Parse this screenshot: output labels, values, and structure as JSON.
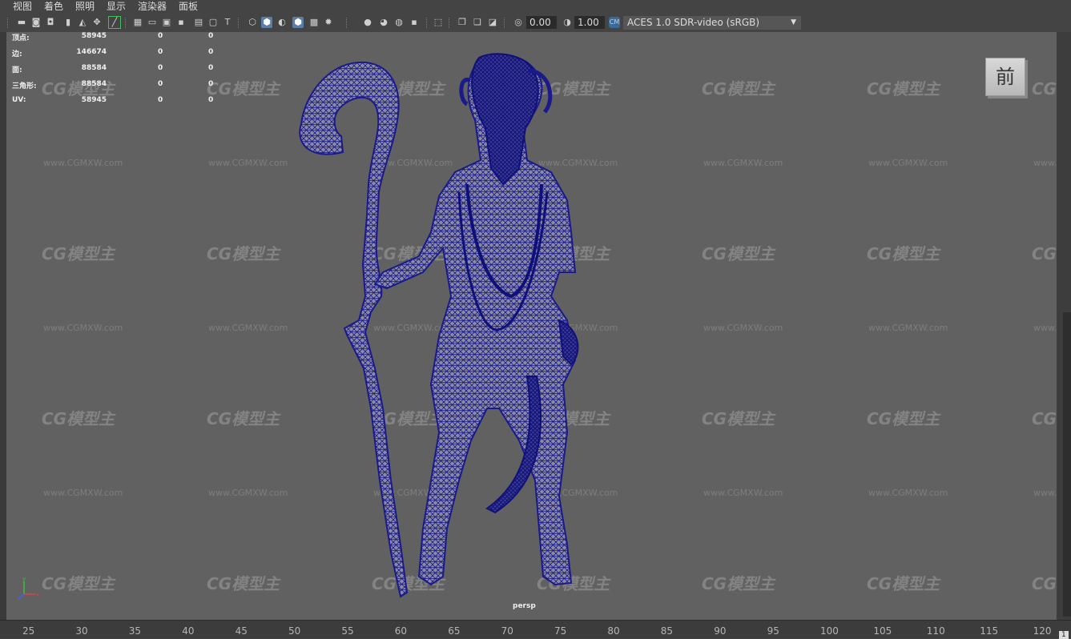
{
  "menu": [
    "视图",
    "着色",
    "照明",
    "显示",
    "渲染器",
    "面板"
  ],
  "toolbar": {
    "exposure_value": "0.00",
    "gamma_value": "1.00",
    "color_space": "ACES 1.0 SDR-video (sRGB)",
    "icons": [
      "camera-icon",
      "bookmark-icon",
      "grid-icon",
      "shading-cube-icon",
      "wireframe-icon",
      "light-icon",
      "isolate-icon",
      "exposure-icon",
      "gamma-icon"
    ]
  },
  "hud": {
    "rows": [
      {
        "label": "顶点:",
        "v1": "58945",
        "v2": "0",
        "v3": "0"
      },
      {
        "label": "边:",
        "v1": "146674",
        "v2": "0",
        "v3": "0"
      },
      {
        "label": "面:",
        "v1": "88584",
        "v2": "0",
        "v3": "0"
      },
      {
        "label": "三角形:",
        "v1": "88584",
        "v2": "0",
        "v3": "0"
      },
      {
        "label": "UV:",
        "v1": "58945",
        "v2": "0",
        "v3": "0"
      }
    ]
  },
  "viewcube_label": "前",
  "camera_label": "persp",
  "axis_labels": {
    "x": "x",
    "y": "y",
    "z": "z"
  },
  "watermark": {
    "logo": "CG模型主",
    "url": "www.CGMXW.com"
  },
  "timeline": {
    "ticks": [
      "25",
      "30",
      "35",
      "40",
      "45",
      "50",
      "55",
      "60",
      "65",
      "70",
      "75",
      "80",
      "85",
      "90",
      "95",
      "100",
      "105",
      "110",
      "115",
      "120"
    ],
    "corner": "1"
  },
  "colors": {
    "viewport": "#616161",
    "wire": "#1a1a8a",
    "panel": "#444444",
    "toolbar_active": "#5a7fa6"
  }
}
